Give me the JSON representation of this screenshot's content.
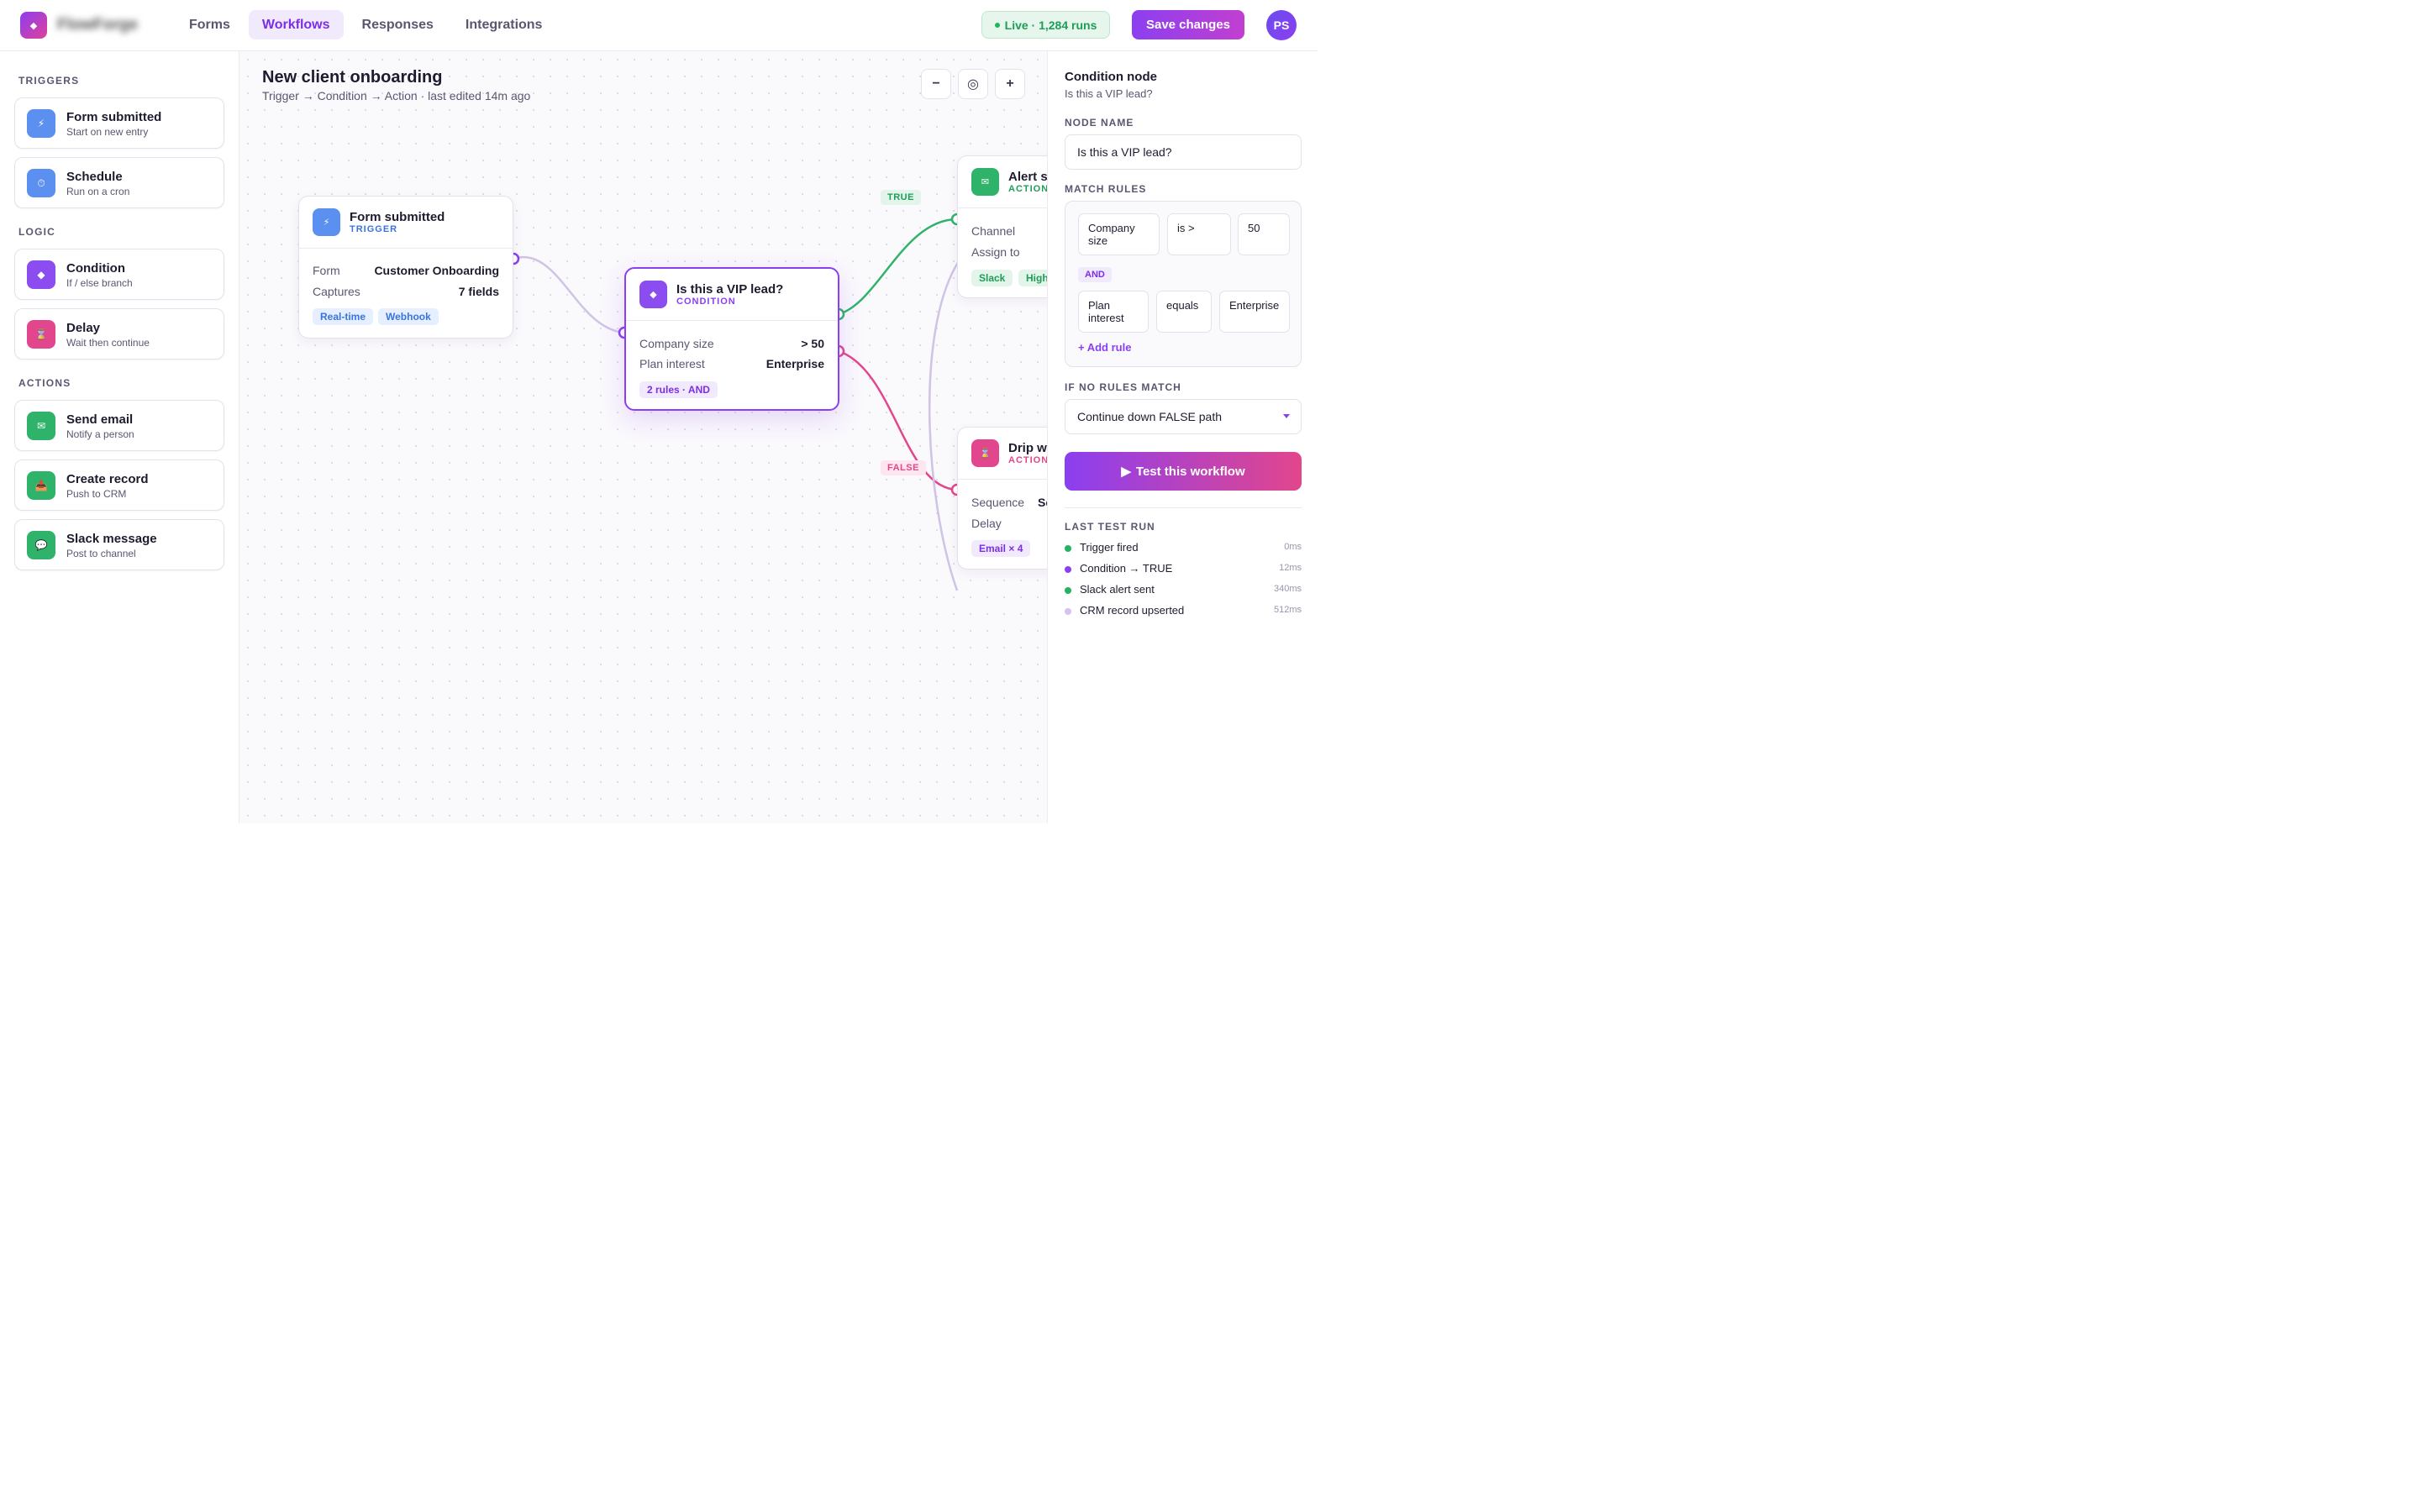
{
  "app": {
    "logo_text": "FlowForge",
    "logo_glyph": "◆"
  },
  "nav": {
    "tabs": [
      {
        "label": "Forms"
      },
      {
        "label": "Workflows",
        "active": true
      },
      {
        "label": "Responses"
      },
      {
        "label": "Integrations"
      }
    ]
  },
  "header": {
    "live_status": "Live · 1,284 runs",
    "save_label": "Save changes",
    "avatar_initials": "PS"
  },
  "palette": {
    "triggers_label": "TRIGGERS",
    "triggers": [
      {
        "title": "Form submitted",
        "subtitle": "Start on new entry",
        "icon": "lightning-icon",
        "glyph": "⚡"
      },
      {
        "title": "Schedule",
        "subtitle": "Run on a cron",
        "icon": "clock-icon",
        "glyph": "⏱"
      }
    ],
    "logic_label": "LOGIC",
    "logic": [
      {
        "title": "Condition",
        "subtitle": "If / else branch",
        "icon": "diamond-icon",
        "glyph": "◆"
      },
      {
        "title": "Delay",
        "subtitle": "Wait then continue",
        "icon": "hourglass-icon",
        "glyph": "⌛"
      }
    ],
    "actions_label": "ACTIONS",
    "actions": [
      {
        "title": "Send email",
        "subtitle": "Notify a person",
        "icon": "envelope-icon",
        "glyph": "✉"
      },
      {
        "title": "Create record",
        "subtitle": "Push to CRM",
        "icon": "inbox-icon",
        "glyph": "📥"
      },
      {
        "title": "Slack message",
        "subtitle": "Post to channel",
        "icon": "chat-icon",
        "glyph": "💬"
      }
    ]
  },
  "canvas": {
    "title": "New client onboarding",
    "subtitle": "Trigger → Condition → Action · last edited 14m ago",
    "zoom": {
      "out": "−",
      "fit": "◎",
      "in": "+"
    },
    "true_label": "TRUE",
    "false_label": "FALSE",
    "nodes": {
      "trigger": {
        "title": "Form submitted",
        "type": "TRIGGER",
        "glyph": "⚡",
        "rows": [
          {
            "label": "Form",
            "value": "Customer Onboarding"
          },
          {
            "label": "Captures",
            "value": "7 fields"
          }
        ],
        "chips": [
          "Real-time",
          "Webhook"
        ]
      },
      "condition": {
        "title": "Is this a VIP lead?",
        "type": "CONDITION",
        "glyph": "◆",
        "rows": [
          {
            "label": "Company size",
            "value": "> 50"
          },
          {
            "label": "Plan interest",
            "value": "Enterprise"
          }
        ],
        "chips": [
          "2 rules · AND"
        ]
      },
      "alert": {
        "title": "Alert sales",
        "type": "ACTION",
        "glyph": "✉",
        "rows": [
          {
            "label": "Channel"
          },
          {
            "label": "Assign to"
          }
        ],
        "chips": [
          "Slack",
          "High"
        ]
      },
      "drip": {
        "title": "Drip welcome",
        "type": "ACTION",
        "glyph": "⌛",
        "rows": [
          {
            "label": "Sequence",
            "value": "Se"
          },
          {
            "label": "Delay"
          }
        ],
        "chips": [
          "Email × 4"
        ]
      }
    }
  },
  "inspector": {
    "title": "Condition node",
    "subtitle": "Is this a VIP lead?",
    "node_name_label": "NODE NAME",
    "node_name_value": "Is this a VIP lead?",
    "match_rules_label": "MATCH RULES",
    "rules": [
      {
        "field": "Company size",
        "operator": "is >",
        "value": "50"
      },
      {
        "field": "Plan interest",
        "operator": "equals",
        "value": "Enterprise"
      }
    ],
    "joiner": "AND",
    "add_rule": "+ Add rule",
    "no_match_label": "IF NO RULES MATCH",
    "no_match_value": "Continue down FALSE path",
    "test_button": "Test this workflow",
    "test_glyph": "▶",
    "last_run_label": "LAST TEST RUN",
    "last_run": [
      {
        "text": "Trigger fired",
        "time": "0ms",
        "color": "#22b45f"
      },
      {
        "text": "Condition → TRUE",
        "time": "12ms",
        "color": "#8b3ff0"
      },
      {
        "text": "Slack alert sent",
        "time": "340ms",
        "color": "#22b45f"
      },
      {
        "text": "CRM record upserted",
        "time": "512ms",
        "color": "#d4c3ee"
      }
    ]
  },
  "colors": {
    "accent": "#8b3ff0",
    "true_wire": "#2fb36a",
    "false_wire": "#e2468c",
    "idle_wire": "#cfc3e6"
  }
}
